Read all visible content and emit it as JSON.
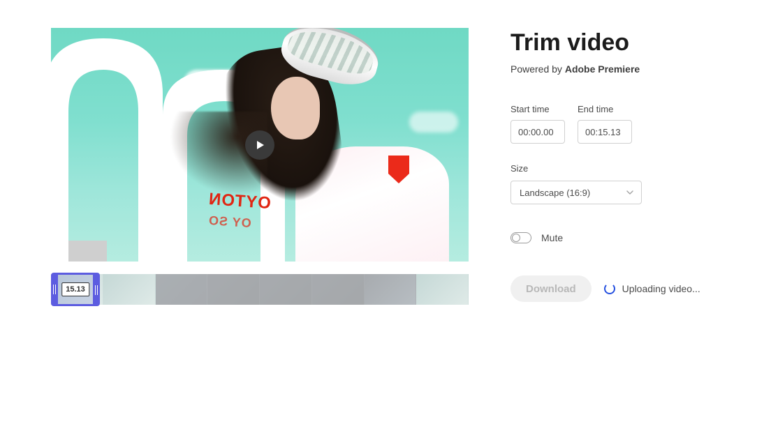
{
  "panel": {
    "title": "Trim video",
    "subtitle_prefix": "Powered by ",
    "subtitle_brand": "Adobe Premiere"
  },
  "times": {
    "start_label": "Start time",
    "start_value": "00:00.00",
    "end_label": "End time",
    "end_value": "00:15.13"
  },
  "size": {
    "label": "Size",
    "selected": "Landscape (16:9)"
  },
  "mute": {
    "label": "Mute",
    "on": false
  },
  "action": {
    "download_label": "Download",
    "download_enabled": false
  },
  "status": {
    "text": "Uploading video..."
  },
  "timeline": {
    "duration_badge": "15.13",
    "thumb_count": 8
  },
  "preview": {
    "jacket_text_main": "OYTON",
    "jacket_text_sub": "OY SO"
  },
  "icons": {
    "play": "play-icon",
    "chevron_down": "chevron-down-icon",
    "spinner": "loading-spinner-icon"
  }
}
